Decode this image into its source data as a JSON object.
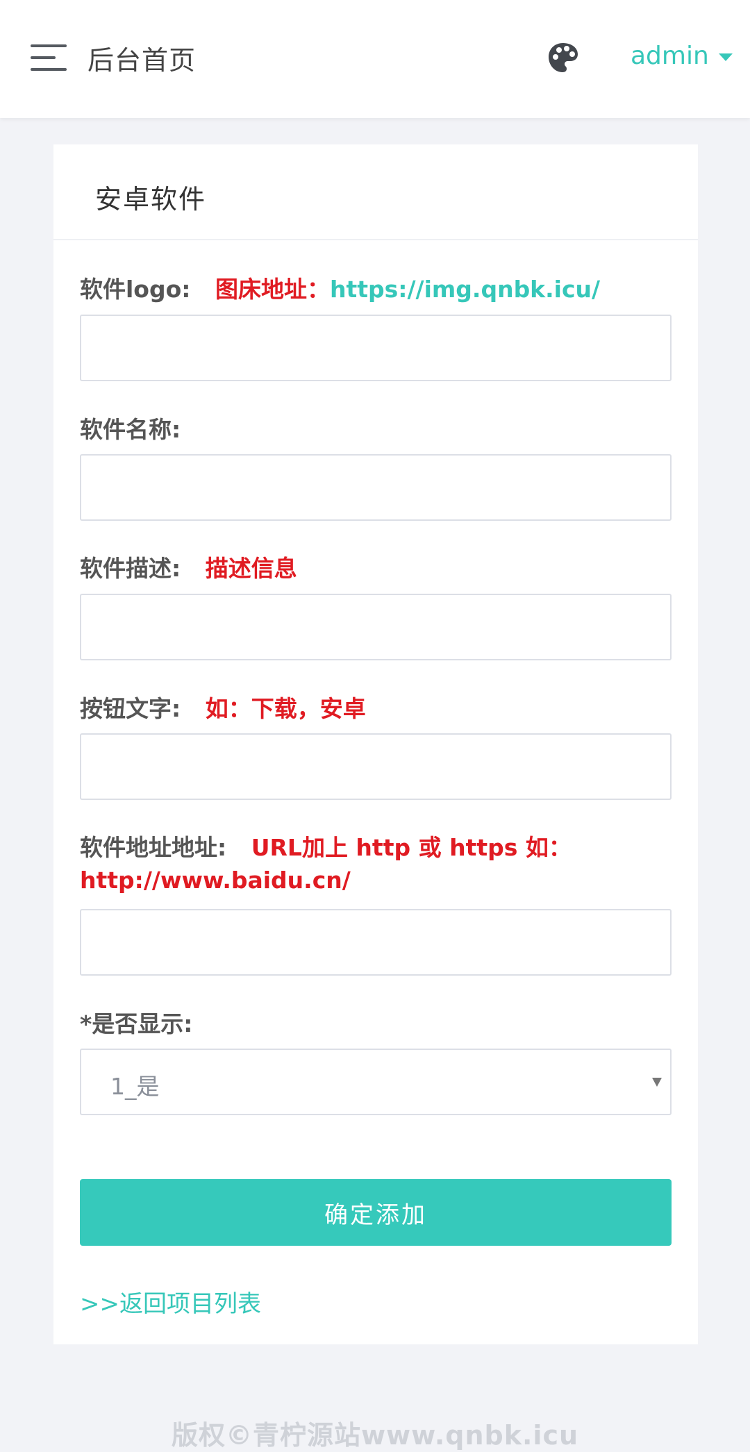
{
  "header": {
    "title": "后台首页",
    "user": "admin",
    "menu_icon": "hamburger-menu-icon",
    "theme_icon": "palette-icon"
  },
  "card": {
    "title": "安卓软件",
    "fields": {
      "logo": {
        "label": "软件logo:",
        "hint_prefix": "图床地址：",
        "hint_link": "https://img.qnbk.icu/",
        "value": ""
      },
      "name": {
        "label": "软件名称:",
        "value": ""
      },
      "desc": {
        "label": "软件描述:",
        "hint": "描述信息",
        "value": ""
      },
      "button_text": {
        "label": "按钮文字:",
        "hint": "如：下载，安卓",
        "value": ""
      },
      "url": {
        "label": "软件地址地址:",
        "hint_line1": "URL加上 http 或 https 如：",
        "hint_line2": "http://www.baidu.cn/",
        "value": ""
      },
      "display": {
        "label": "*是否显示:",
        "selected": "1_是"
      }
    },
    "submit_label": "确定添加",
    "back_link": ">>返回项目列表"
  },
  "footer": {
    "copyright": "版权©青柠源站www.qnbk.icu"
  },
  "colors": {
    "accent": "#36c9bb",
    "hint_red": "#e01b22",
    "background": "#f2f3f7"
  }
}
